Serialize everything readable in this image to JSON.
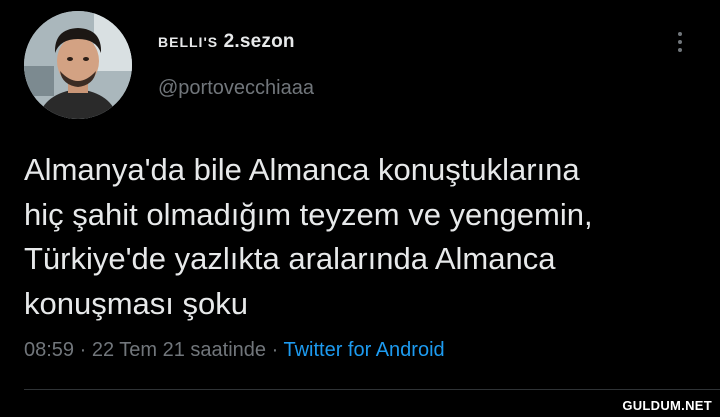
{
  "tweet": {
    "display_name_prefix": "BELLI'S",
    "display_name_suffix": " 2.sezon",
    "handle": "@portovecchiaaa",
    "text": "Almanya'da bile Almanca konuştuklarına\nhiç şahit olmadığım teyzem ve yengemin,\nTürkiye'de yazlıkta aralarında Almanca\nkonuşması şoku",
    "time": "08:59",
    "separator": " · ",
    "date": "22 Tem 21 saatinde",
    "source": "Twitter for Android"
  },
  "watermark": "GULDUM.NET",
  "colors": {
    "background": "#000000",
    "text": "#e7e9ea",
    "secondary": "#71767b",
    "link": "#1d9bf0"
  },
  "icons": {
    "more": "more-vertical-icon"
  }
}
